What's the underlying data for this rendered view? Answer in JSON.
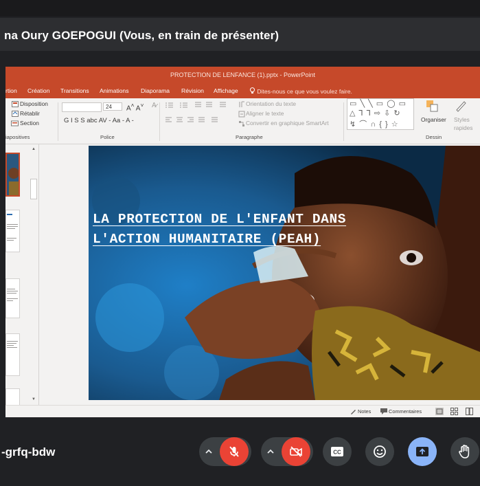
{
  "presenter": {
    "text": "na Oury GOEPOGUI (Vous, en train de présenter)"
  },
  "ppt": {
    "title": "PROTECTION DE LENFANCE (1).pptx - PowerPoint",
    "tabs": [
      "rtion",
      "Création",
      "Transitions",
      "Animations",
      "Diaporama",
      "Révision",
      "Affichage"
    ],
    "search_placeholder": "Dites-nous ce que vous voulez faire.",
    "ribbon": {
      "disposition": "Disposition",
      "retablir": "Rétablir",
      "section": "Section",
      "font_size": "24",
      "font_buttons": "G  I  S  S  abc  AV -  Aa -   A -",
      "orientation": "Orientation du texte",
      "aligner": "Aligner le texte",
      "convertir": "Convertir en graphique SmartArt",
      "organiser": "Organiser",
      "styles": "Styles",
      "rapides": "rapides",
      "groups": {
        "diapositives": "iapositives",
        "police": "Police",
        "paragraphe": "Paragraphe",
        "dessin": "Dessin"
      }
    },
    "slide": {
      "title_line1": "LA PROTECTION DE L'ENFANT DANS",
      "title_line2": "L'ACTION HUMANITAIRE (PEAH)"
    },
    "status": {
      "notes": "Notes",
      "commentaires": "Commentaires"
    }
  },
  "meeting": {
    "code": "-grfq-bdw"
  },
  "colors": {
    "ppt_accent": "#c6492a",
    "meet_bg": "#202124",
    "mic_off_red": "#ea4335",
    "present_blue": "#8ab4f8"
  },
  "controls": [
    {
      "name": "mic",
      "state": "off",
      "icon": "mic-off-icon"
    },
    {
      "name": "camera",
      "state": "off",
      "icon": "camera-off-icon"
    },
    {
      "name": "captions",
      "icon": "captions-icon"
    },
    {
      "name": "reactions",
      "icon": "emoji-icon"
    },
    {
      "name": "present",
      "state": "active",
      "icon": "present-screen-icon"
    },
    {
      "name": "raise-hand",
      "icon": "hand-icon"
    }
  ]
}
